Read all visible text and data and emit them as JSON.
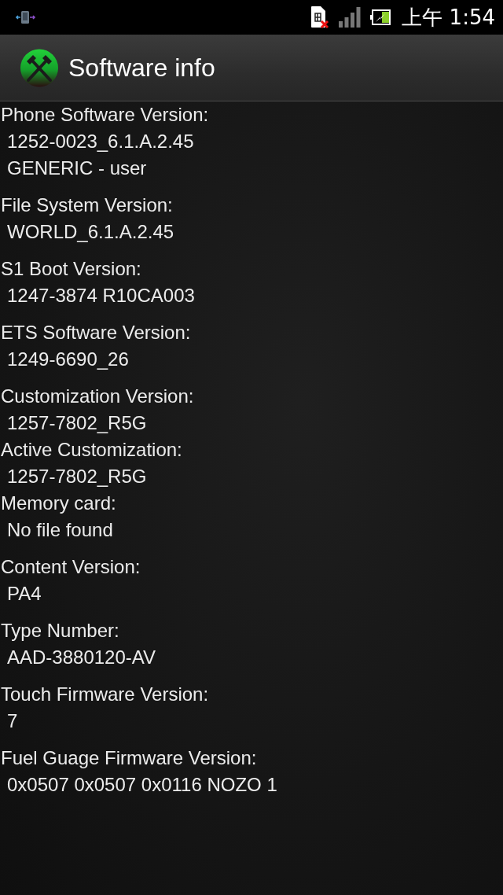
{
  "status_bar": {
    "time": "上午 1:54"
  },
  "app_bar": {
    "title": "Software info"
  },
  "groups": [
    {
      "entries": [
        {
          "label": "Phone Software Version:",
          "values": [
            "1252-0023_6.1.A.2.45",
            "GENERIC - user"
          ]
        }
      ]
    },
    {
      "entries": [
        {
          "label": "File System Version:",
          "values": [
            "WORLD_6.1.A.2.45"
          ]
        }
      ]
    },
    {
      "entries": [
        {
          "label": "S1 Boot Version:",
          "values": [
            "1247-3874 R10CA003"
          ]
        }
      ]
    },
    {
      "entries": [
        {
          "label": "ETS Software Version:",
          "values": [
            "1249-6690_26"
          ]
        }
      ]
    },
    {
      "entries": [
        {
          "label": "Customization Version:",
          "values": [
            "1257-7802_R5G"
          ]
        },
        {
          "label": "Active Customization:",
          "values": [
            "1257-7802_R5G"
          ]
        },
        {
          "label": "Memory card:",
          "values": [
            "No file found"
          ]
        }
      ]
    },
    {
      "entries": [
        {
          "label": "Content Version:",
          "values": [
            "PA4"
          ]
        }
      ]
    },
    {
      "entries": [
        {
          "label": "Type Number:",
          "values": [
            "AAD-3880120-AV"
          ]
        }
      ]
    },
    {
      "entries": [
        {
          "label": "Touch Firmware Version:",
          "values": [
            "7"
          ]
        }
      ]
    },
    {
      "entries": [
        {
          "label": "Fuel Guage Firmware Version:",
          "values": [
            "0x0507 0x0507 0x0116 NOZO 1"
          ]
        }
      ]
    }
  ]
}
